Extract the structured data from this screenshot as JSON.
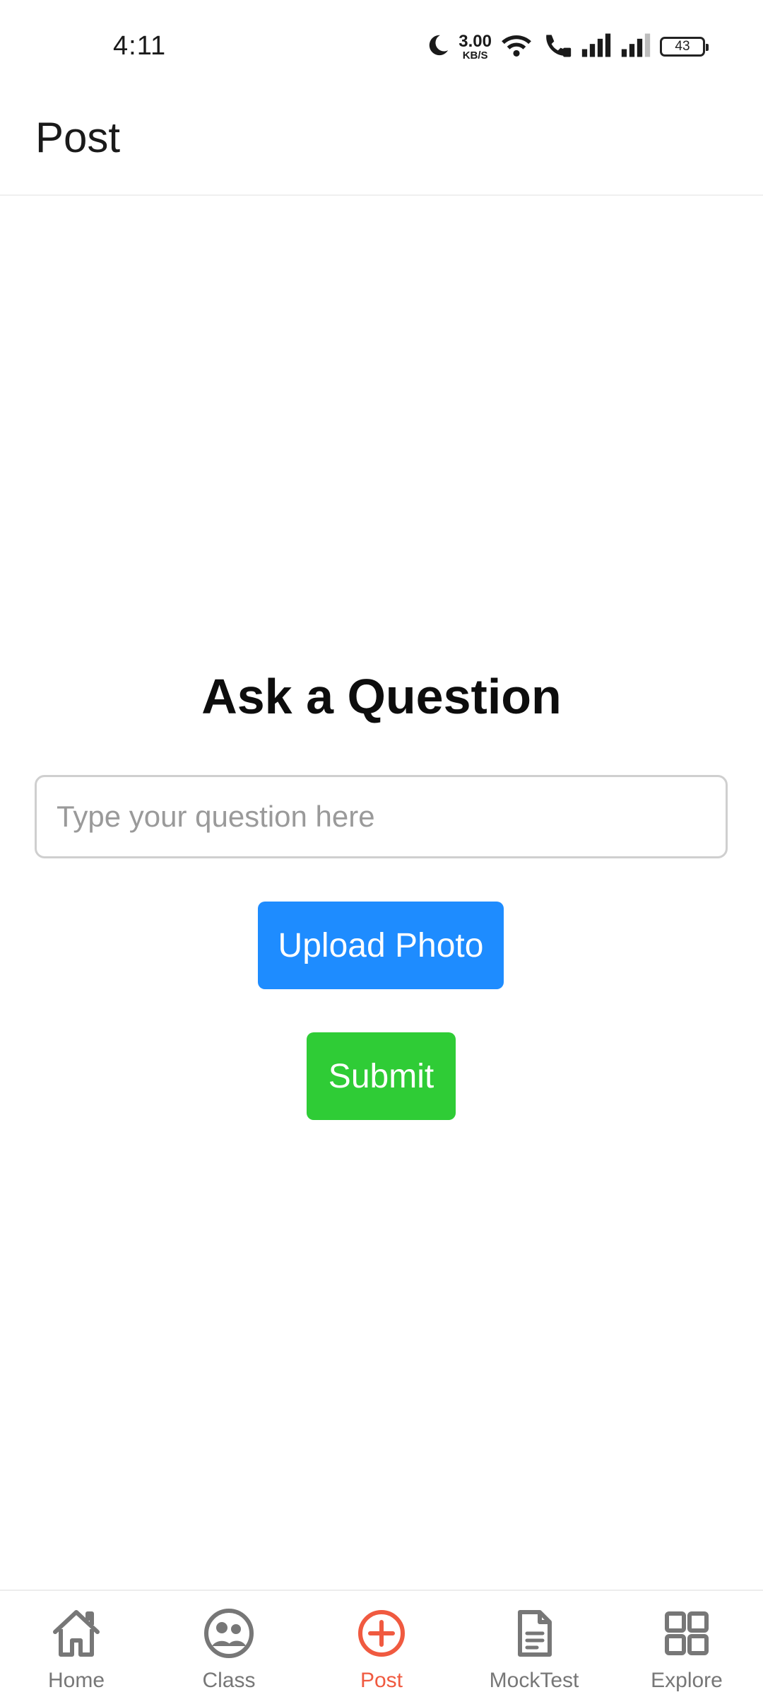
{
  "status_bar": {
    "time": "4:11",
    "net_speed_value": "3.00",
    "net_speed_unit": "KB/S",
    "battery": "43"
  },
  "app_bar": {
    "title": "Post"
  },
  "main": {
    "heading": "Ask a Question",
    "question_input": {
      "value": "",
      "placeholder": "Type your question here"
    },
    "upload_button": "Upload Photo",
    "submit_button": "Submit"
  },
  "bottom_nav": {
    "items": [
      {
        "label": "Home",
        "icon": "home-icon",
        "active": false
      },
      {
        "label": "Class",
        "icon": "class-icon",
        "active": false
      },
      {
        "label": "Post",
        "icon": "add-circle-icon",
        "active": true
      },
      {
        "label": "MockTest",
        "icon": "document-icon",
        "active": false
      },
      {
        "label": "Explore",
        "icon": "grid-icon",
        "active": false
      }
    ]
  },
  "colors": {
    "accent_active": "#f05a40",
    "upload_button": "#1e8cff",
    "submit_button": "#2fcc36",
    "nav_inactive": "#777777"
  }
}
